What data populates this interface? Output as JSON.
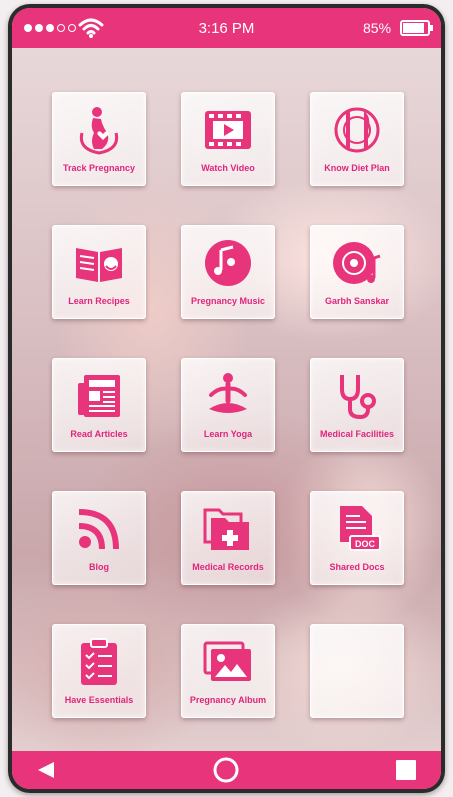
{
  "status_bar": {
    "time": "3:16 PM",
    "battery": "85%",
    "signal_bars_filled": 3,
    "signal_bars_total": 5,
    "battery_level": 0.85
  },
  "colors": {
    "accent": "#e8347a",
    "label": "#e0257a"
  },
  "tiles": [
    {
      "label": "Track Pregnancy",
      "icon": "pregnancy-icon"
    },
    {
      "label": "Watch Video",
      "icon": "video-icon"
    },
    {
      "label": "Know Diet Plan",
      "icon": "diet-plan-icon"
    },
    {
      "label": "Learn Recipes",
      "icon": "recipe-book-icon"
    },
    {
      "label": "Pregnancy Music",
      "icon": "music-icon"
    },
    {
      "label": "Garbh Sanskar",
      "icon": "cd-music-icon"
    },
    {
      "label": "Read Articles",
      "icon": "newspaper-icon"
    },
    {
      "label": "Learn Yoga",
      "icon": "yoga-icon"
    },
    {
      "label": "Medical Facilities",
      "icon": "stethoscope-icon"
    },
    {
      "label": "Blog",
      "icon": "rss-icon"
    },
    {
      "label": "Medical Records",
      "icon": "medical-folder-icon"
    },
    {
      "label": "Shared Docs",
      "icon": "document-icon"
    },
    {
      "label": "Have Essentials",
      "icon": "checklist-icon"
    },
    {
      "label": "Pregnancy Album",
      "icon": "photo-album-icon"
    }
  ],
  "nav_bar": {
    "icons": [
      "back-icon",
      "home-icon",
      "recent-apps-icon"
    ]
  }
}
